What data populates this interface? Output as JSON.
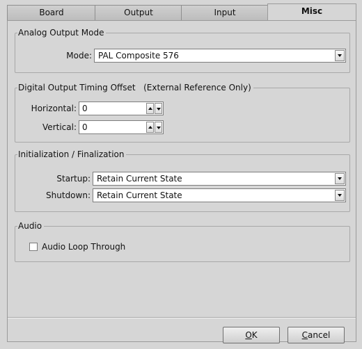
{
  "tabs": [
    "Board",
    "Output",
    "Input",
    "Misc"
  ],
  "active_tab": "Misc",
  "analog": {
    "legend": "Analog Output Mode",
    "mode_label": "Mode:",
    "mode_value": "PAL Composite 576"
  },
  "digital": {
    "legend": "Digital Output Timing Offset   (External Reference Only)",
    "horizontal_label": "Horizontal:",
    "horizontal_value": "0",
    "vertical_label": "Vertical:",
    "vertical_value": "0"
  },
  "init": {
    "legend": "Initialization / Finalization",
    "startup_label": "Startup:",
    "startup_value": "Retain Current State",
    "shutdown_label": "Shutdown:",
    "shutdown_value": "Retain Current State"
  },
  "audio": {
    "legend": "Audio",
    "loop_label": "Audio Loop Through",
    "loop_checked": false
  },
  "buttons": {
    "ok_mnemonic": "O",
    "ok_rest": "K",
    "cancel_mnemonic": "C",
    "cancel_rest": "ancel"
  }
}
